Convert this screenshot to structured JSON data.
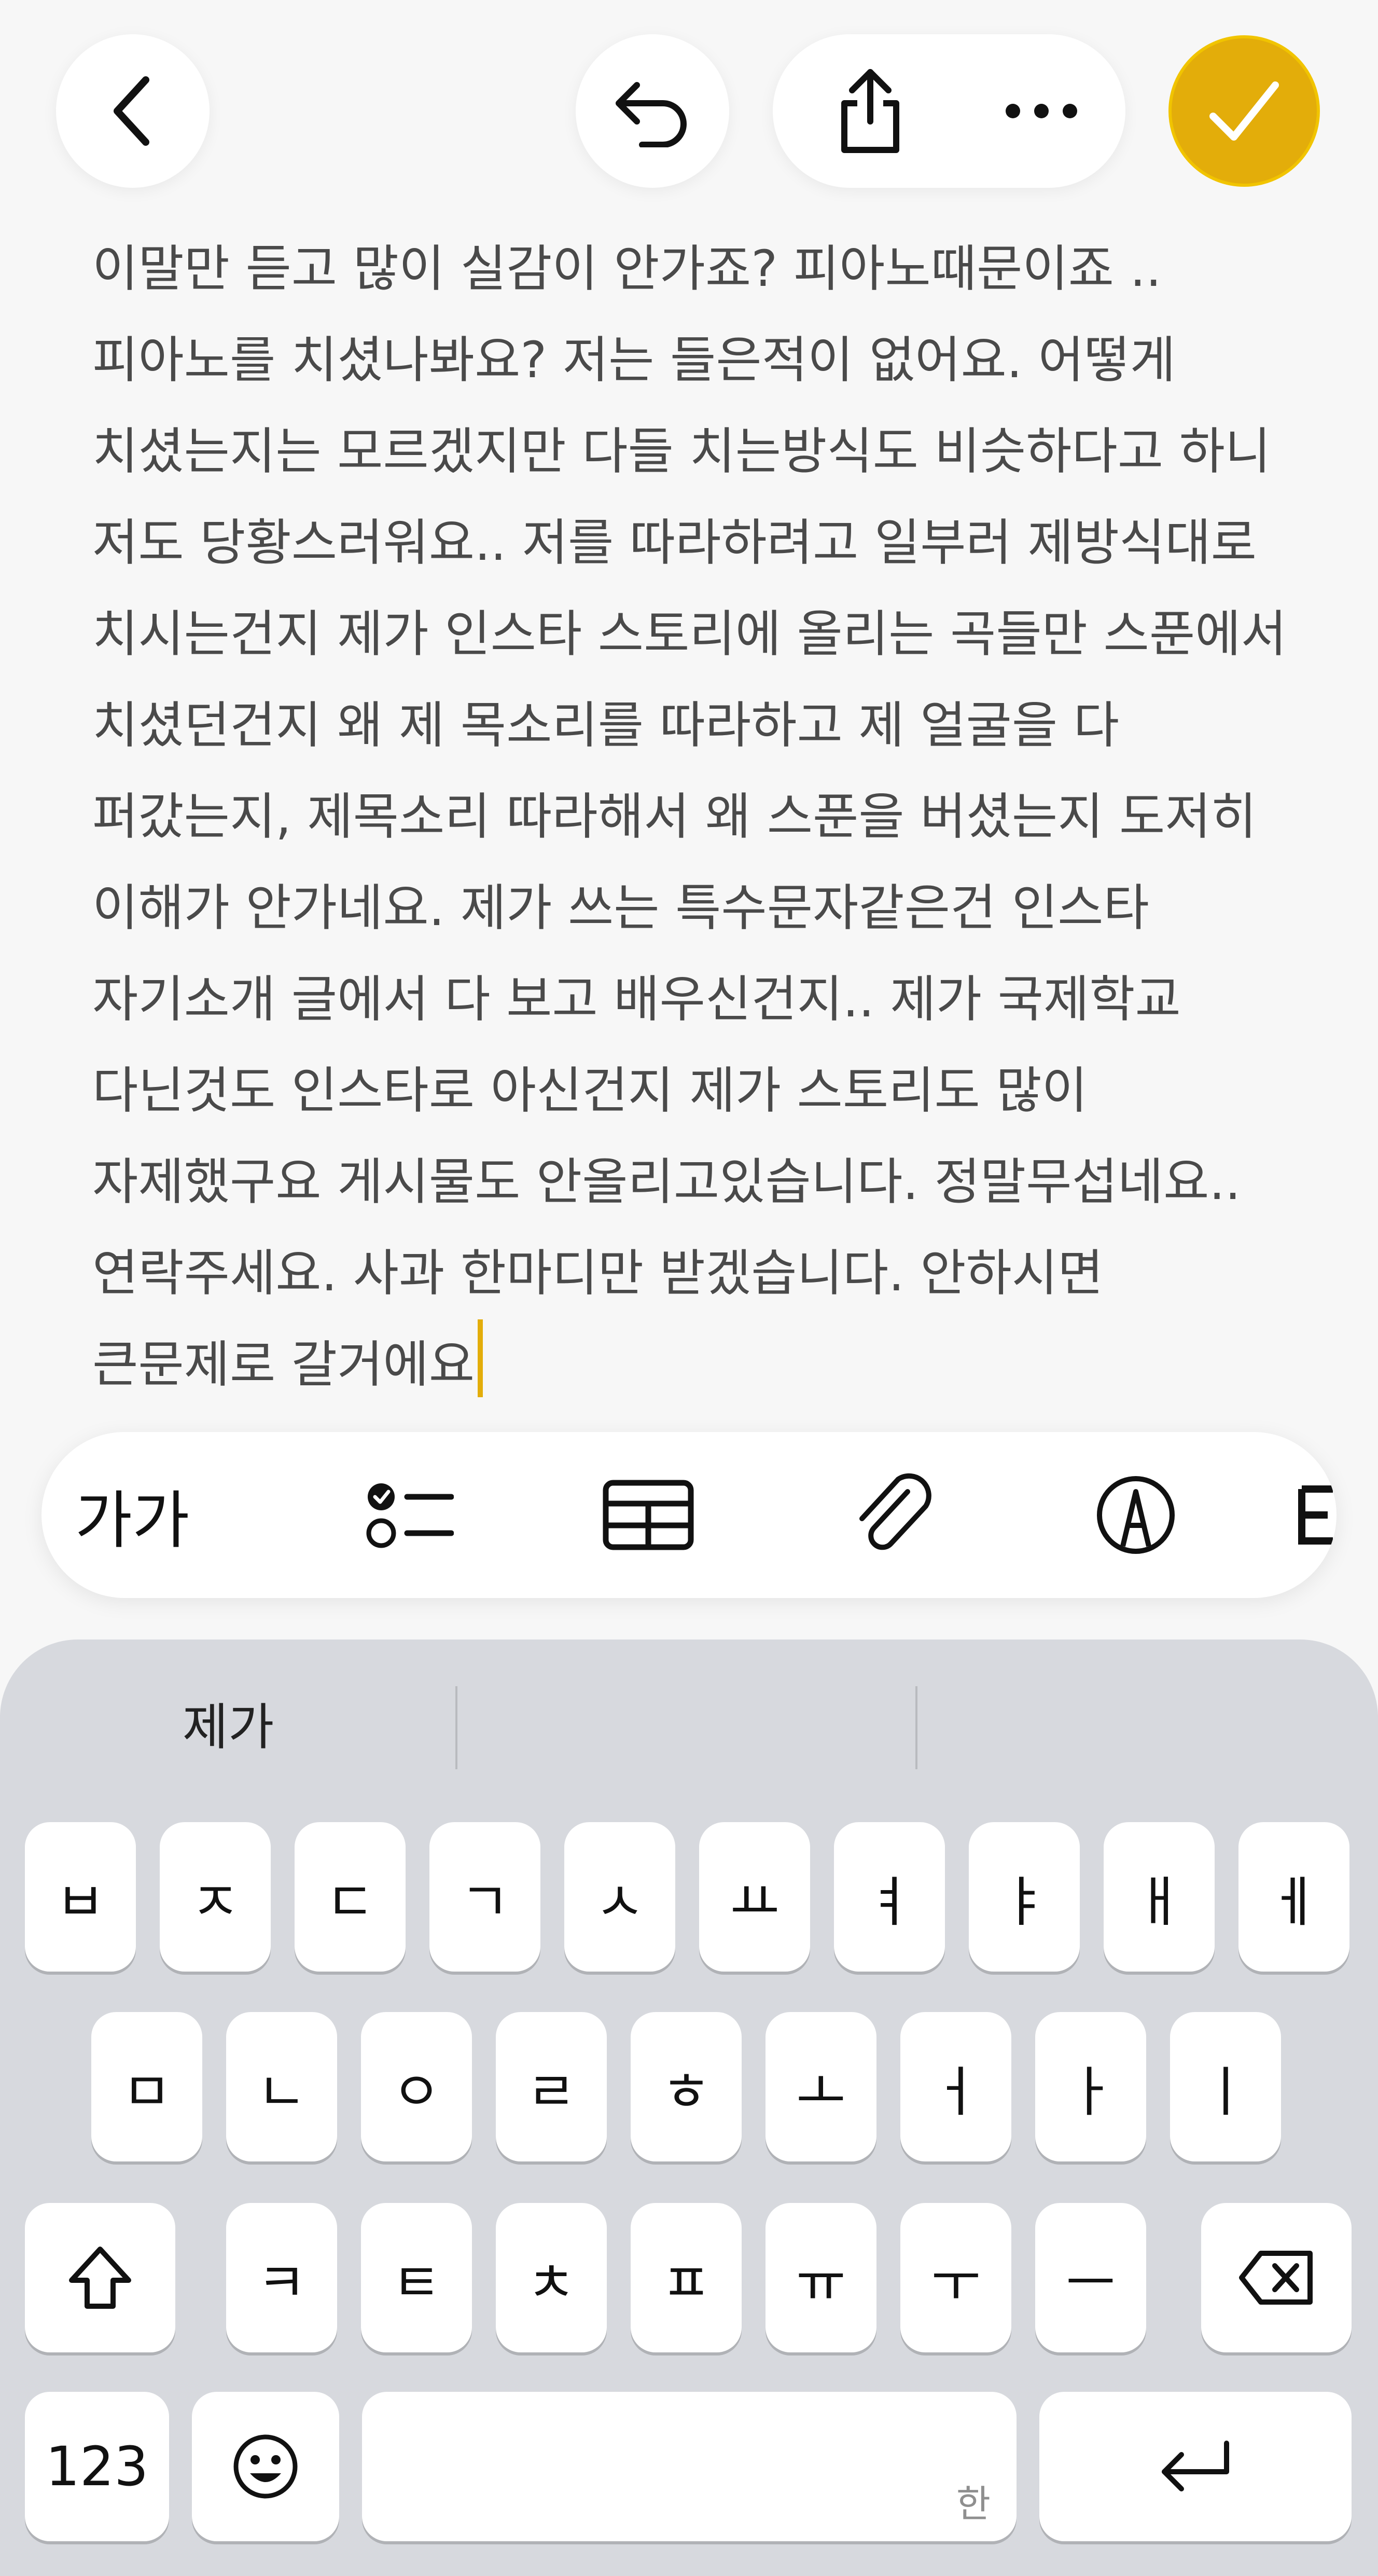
{
  "top_bar": {
    "back_icon": "chevron-left-icon",
    "undo_icon": "undo-icon",
    "share_icon": "share-icon",
    "more_icon": "ellipsis-icon",
    "done_icon": "checkmark-icon",
    "done_color": "#e3ad0a"
  },
  "note": {
    "text": "이말만 듣고 많이 실감이 안가죠? 피아노때문이죠 .. 피아노를 치셨나봐요? 저는 들은적이 없어요. 어떻게 치셨는지는 모르겠지만 다들 치는방식도 비슷하다고 하니 저도 당황스러워요.. 저를 따라하려고 일부러 제방식대로 치시는건지 제가 인스타 스토리에 올리는 곡들만 스푼에서 치셨던건지 왜 제 목소리를 따라하고 제 얼굴을 다 퍼갔는지, 제목소리 따라해서 왜 스푼을 버셨는지 도저히 이해가 안가네요. 제가 쓰는 특수문자같은건 인스타 자기소개 글에서 다 보고 배우신건지.. 제가 국제학교 다닌것도 인스타로 아신건지 제가 스토리도 많이 자제했구요 게시물도 안올리고있습니다. 정말무섭네요.. 연락주세요. 사과 한마디만 받겠습니다. 안하시면 큰문제로 갈거에요",
    "caret_color": "#e3ad0a"
  },
  "toolbar": {
    "format_label": "가가",
    "checklist_icon": "checklist-icon",
    "table_icon": "table-icon",
    "attachment_icon": "paperclip-icon",
    "markup_icon": "markup-pen-icon",
    "apple_intelligence_icon": "writing-tools-icon"
  },
  "keyboard": {
    "suggestions": [
      "제가",
      "",
      ""
    ],
    "row1": [
      "ㅂ",
      "ㅈ",
      "ㄷ",
      "ㄱ",
      "ㅅ",
      "ㅛ",
      "ㅕ",
      "ㅑ",
      "ㅐ",
      "ㅔ"
    ],
    "row2": [
      "ㅁ",
      "ㄴ",
      "ㅇ",
      "ㄹ",
      "ㅎ",
      "ㅗ",
      "ㅓ",
      "ㅏ",
      "ㅣ"
    ],
    "row3": [
      "ㅋ",
      "ㅌ",
      "ㅊ",
      "ㅍ",
      "ㅠ",
      "ㅜ",
      "ㅡ"
    ],
    "shift_icon": "shift-icon",
    "delete_icon": "backspace-icon",
    "numbers_label": "123",
    "emoji_icon": "emoji-icon",
    "space_hint": "한",
    "return_icon": "return-icon"
  }
}
